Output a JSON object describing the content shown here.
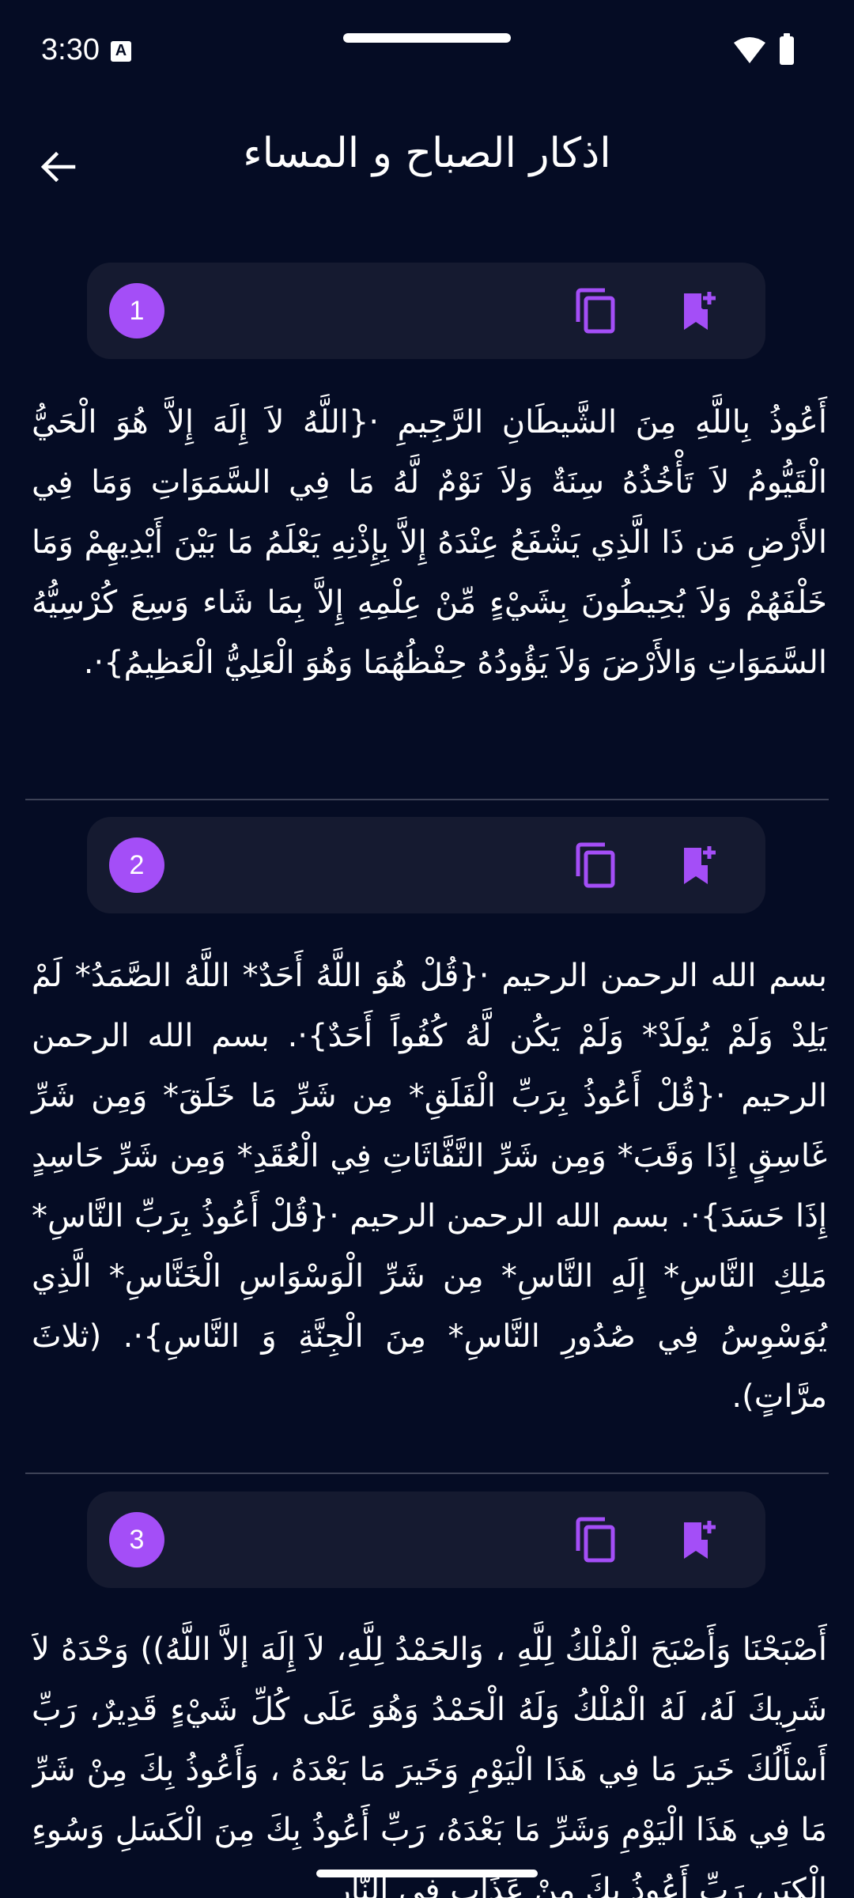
{
  "status_bar": {
    "time": "3:30",
    "a_badge": "A"
  },
  "header": {
    "title": "اذكار الصباح و المساء"
  },
  "cards": [
    {
      "number": "1",
      "text": "أَعُوذُ بِاللَّهِ مِنَ الشَّيطَانِ الرَّجِيمِ ·{اللَّهُ لاَ إِلَهَ إِلاَّ هُوَ الْحَيُّ الْقَيُّومُ لاَ تَأْخُذُهُ سِنَةٌ وَلاَ نَوْمٌ لَّهُ مَا فِي السَّمَوَاتِ وَمَا فِي الأَرْضِ مَن ذَا الَّذِي يَشْفَعُ عِنْدَهُ إِلاَّ بِإِذْنِهِ يَعْلَمُ مَا بَيْنَ أَيْدِيهِمْ وَمَا خَلْفَهُمْ وَلاَ يُحِيطُونَ بِشَيْءٍ مِّنْ عِلْمِهِ إِلاَّ بِمَا شَاء وَسِعَ كُرْسِيُّهُ السَّمَوَاتِ وَالأَرْضَ وَلاَ يَؤُودُهُ حِفْظُهُمَا وَهُوَ الْعَلِيُّ الْعَظِيمُ}·."
    },
    {
      "number": "2",
      "text": "بسم الله الرحمن الرحيم ·{قُلْ هُوَ اللَّهُ أَحَدٌ* اللَّهُ الصَّمَدُ* لَمْ يَلِدْ وَلَمْ يُولَدْ* وَلَمْ يَكُن لَّهُ كُفُواً أَحَدٌ}·. بسم الله الرحمن الرحيم ·{قُلْ أَعُوذُ بِرَبِّ الْفَلَقِ* مِن شَرِّ مَا خَلَقَ* وَمِن شَرِّ غَاسِقٍ إِذَا وَقَبَ* وَمِن شَرِّ النَّفَّاثَاتِ فِي الْعُقَدِ* وَمِن شَرِّ حَاسِدٍ إِذَا حَسَدَ}·. بسم الله الرحمن الرحيم ·{قُلْ أَعُوذُ بِرَبِّ النَّاسِ* مَلِكِ النَّاسِ* إِلَهِ النَّاسِ* مِن شَرِّ الْوَسْوَاسِ الْخَنَّاسِ* الَّذِي يُوَسْوِسُ فِي صُدُورِ النَّاسِ* مِنَ الْجِنَّةِ وَ النَّاسِ}·. (ثلاثَ مرَّاتٍ)."
    },
    {
      "number": "3",
      "text": "أَصْبَحْنَا وَأَصْبَحَ الْمُلْكُ لِلَّهِ ، وَالحَمْدُ لِلَّهِ، لاَ إِلَهَ إلاَّ اللَّهُ)) وَحْدَهُ لاَ شَرِيكَ لَهُ، لَهُ الْمُلْكُ وَلَهُ الْحَمْدُ وَهُوَ عَلَى كُلِّ شَيْءٍ قَدِيرٌ، رَبِّ أَسْأَلُكَ خَيرَ مَا فِي هَذَا الْيَوْمِ وَخَيرَ مَا بَعْدَهُ ، وَأَعُوذُ بِكَ مِنْ شَرِّ مَا فِي هَذَا الْيَوْمِ وَشَرِّ مَا بَعْدَهُ، رَبِّ أَعُوذُ بِكَ مِنَ الْكَسَلِ وَسُوءِ الْكِبَرِ، رَبِّ أَعُوذُ بِكَ مِنْ عَذَابٍ فِي النَّارِ"
    }
  ]
}
